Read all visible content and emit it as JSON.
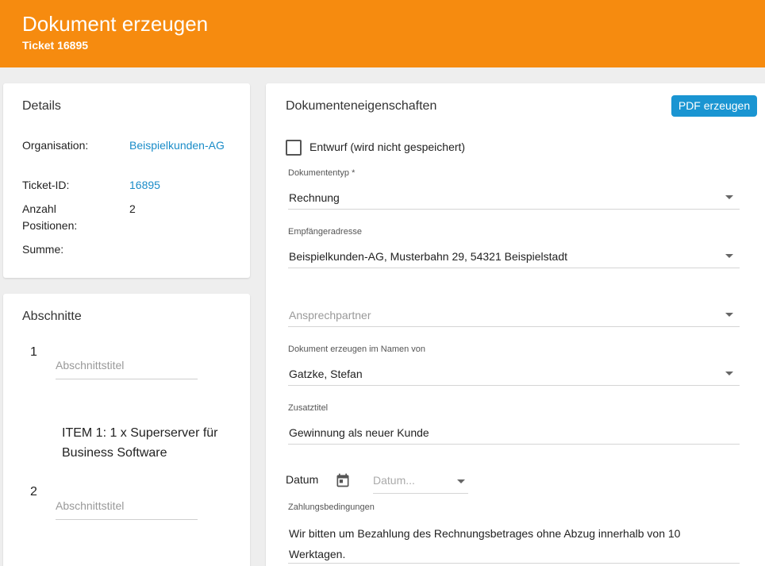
{
  "header": {
    "title": "Dokument erzeugen",
    "subtitle": "Ticket 16895"
  },
  "details": {
    "title": "Details",
    "rows": [
      {
        "label": "Organisation:",
        "value": "Beispielkunden-AG",
        "is_link": true
      },
      {
        "label": "Ticket-ID:",
        "value": "16895",
        "is_link": true
      },
      {
        "label": "Anzahl Positionen:",
        "value": "2",
        "is_link": false
      },
      {
        "label": "Summe:",
        "value": "",
        "is_link": false
      }
    ]
  },
  "sections": {
    "title": "Abschnitte",
    "items": [
      {
        "number": "1",
        "placeholder": "Abschnittstitel"
      },
      {
        "number": "2",
        "placeholder": "Abschnittstitel"
      }
    ],
    "item_text": "ITEM 1: 1 x Superserver für Business Software"
  },
  "properties": {
    "title": "Dokumenteneigenschaften",
    "pdf_button": "PDF erzeugen",
    "draft_checkbox": {
      "label": "Entwurf (wird nicht gespeichert)",
      "checked": false
    },
    "document_type": {
      "label": "Dokumententyp *",
      "value": "Rechnung"
    },
    "recipient_address": {
      "label": "Empfängeradresse",
      "value": "Beispielkunden-AG, Musterbahn 29, 54321 Beispielstadt"
    },
    "contact_person": {
      "placeholder": "Ansprechpartner"
    },
    "created_on_behalf": {
      "label": "Dokument erzeugen im Namen von",
      "value": "Gatzke, Stefan"
    },
    "additional_title": {
      "label": "Zusatztitel",
      "value": "Gewinnung als neuer Kunde"
    },
    "date": {
      "label": "Datum",
      "placeholder": "Datum..."
    },
    "payment_terms": {
      "label": "Zahlungsbedingungen",
      "value": "Wir bitten um Bezahlung des Rechnungsbetrages ohne Abzug innerhalb von 10 Werktagen."
    }
  },
  "colors": {
    "header": "#f68b0f",
    "link": "#1a8cc8",
    "button": "#1a95d2"
  }
}
